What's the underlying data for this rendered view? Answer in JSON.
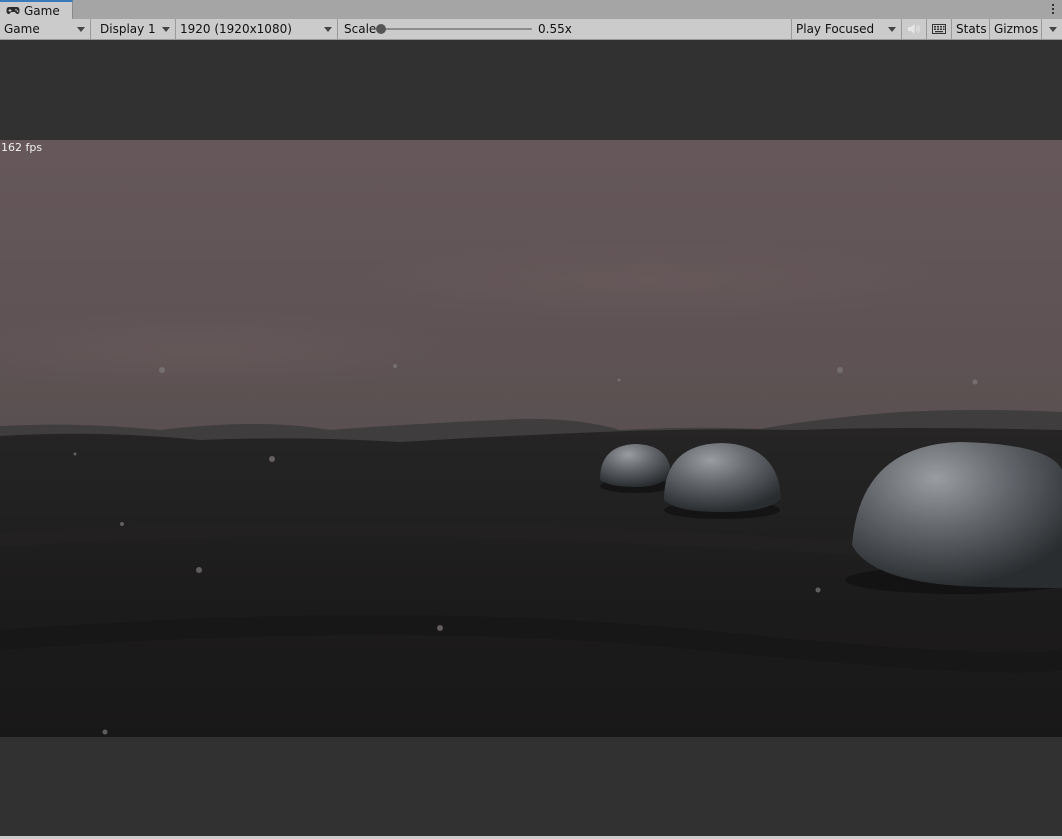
{
  "tab": {
    "label": "Game",
    "icon": "gamepad-icon"
  },
  "toolbar": {
    "view_select": "Game",
    "display_select": "Display 1",
    "resolution_select": "1920 (1920x1080)",
    "scale_label": "Scale",
    "scale_value": "0.55x",
    "scale_level": 0.0,
    "play_mode_select": "Play Focused",
    "mute_icon": "speaker-muted-icon",
    "stats_icon": "keyboard-grid-icon",
    "stats_label": "Stats",
    "gizmos_label": "Gizmos"
  },
  "game": {
    "fps": "162 fps"
  },
  "colors": {
    "tab_accent": "#3a79bb",
    "toolbar_bg": "#cbcbcb",
    "tabbar_bg": "#a5a5a5",
    "viewport_bg": "#313131"
  }
}
